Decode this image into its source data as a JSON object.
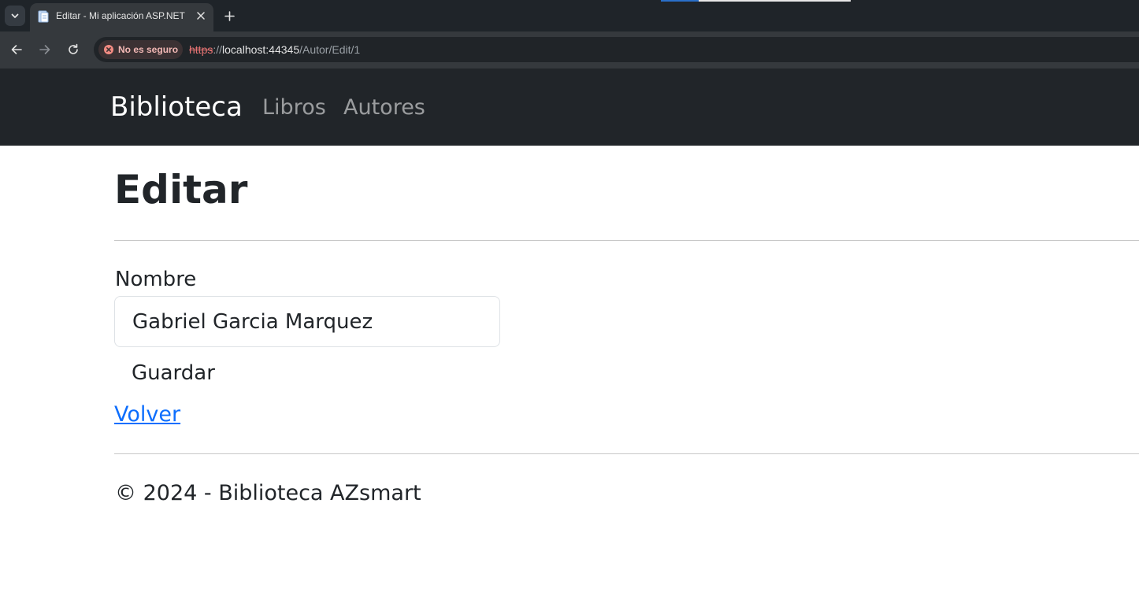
{
  "browser": {
    "tab": {
      "title": "Editar - Mi aplicación ASP.NET",
      "favicon": "page-icon"
    },
    "security_label": "No es seguro",
    "url": {
      "scheme": "https",
      "separator": "://",
      "host": "localhost:44345",
      "path": "/Autor/Edit/1"
    },
    "colors": {
      "tabstrip": "#1f2429",
      "toolbar": "#35393d",
      "insecure_text": "#f2b8b5",
      "insecure_scheme": "#e57373"
    }
  },
  "navbar": {
    "brand": "Biblioteca",
    "links": [
      {
        "label": "Libros"
      },
      {
        "label": "Autores"
      }
    ],
    "background": "#212529"
  },
  "main": {
    "title": "Editar",
    "form": {
      "label": "Nombre",
      "value": "Gabriel Garcia Marquez",
      "submit_label": "Guardar"
    },
    "back_link": "Volver",
    "link_color": "#0d6efd"
  },
  "footer": {
    "text": "© 2024 - Biblioteca AZsmart"
  }
}
